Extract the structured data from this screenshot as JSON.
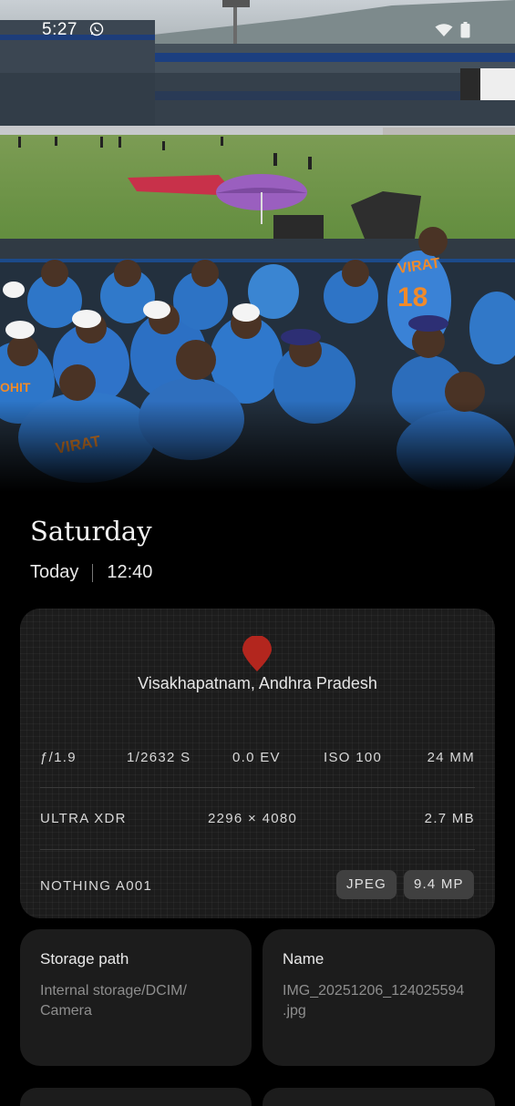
{
  "status_bar": {
    "time": "5:27",
    "icons": [
      "whatsapp-icon",
      "wifi-icon",
      "battery-icon"
    ]
  },
  "photo": {
    "description_icons": [
      "stadium-photo"
    ],
    "jersey_text": [
      "VIRAT",
      "18",
      "ROHIT"
    ]
  },
  "date": {
    "day": "Saturday",
    "relative": "Today",
    "time": "12:40"
  },
  "details": {
    "location": "Visakhapatnam, Andhra Pradesh",
    "aperture": "ƒ/1.9",
    "shutter": "1/2632 S",
    "exposure": "0.0 EV",
    "iso": "ISO 100",
    "focal_length": "24 MM",
    "mode": "ULTRA XDR",
    "resolution": "2296 × 4080",
    "file_size": "2.7 MB",
    "device": "NOTHING A001",
    "format_chip": "JPEG",
    "megapixel_chip": "9.4 MP"
  },
  "storage": {
    "label": "Storage path",
    "value": "Internal storage/DCIM/\nCamera"
  },
  "name": {
    "label": "Name",
    "value": "IMG_20251206_124025594\n.jpg"
  },
  "colors": {
    "background": "#000000",
    "card": "#1c1c1c",
    "chip": "#404040",
    "pin": "#b3261e",
    "jersey": "#2f73c9"
  }
}
